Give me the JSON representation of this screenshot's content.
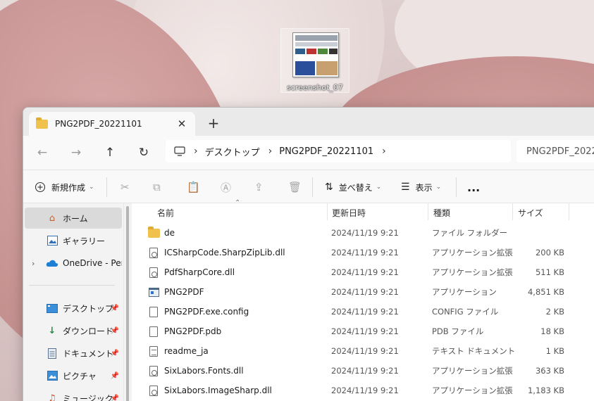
{
  "desktop": {
    "icon_label": "screenshot_07"
  },
  "tab": {
    "title": "PNG2PDF_20221101",
    "close": "✕",
    "new": "+"
  },
  "nav": {
    "back": "←",
    "forward": "→",
    "up": "↑",
    "refresh": "↻",
    "breadcrumbs": [
      "デスクトップ",
      "PNG2PDF_20221101"
    ],
    "search_text": "PNG2PDF_2022"
  },
  "toolbar": {
    "new_label": "新規作成",
    "sort_label": "並べ替え",
    "view_label": "表示",
    "more": "..."
  },
  "sidebar": {
    "items": [
      {
        "label": "ホーム",
        "icon": "home-icon"
      },
      {
        "label": "ギャラリー",
        "icon": "gallery-icon"
      },
      {
        "label": "OneDrive - Perso",
        "icon": "onedrive-icon"
      },
      {
        "label": "デスクトップ",
        "icon": "desktop-icon"
      },
      {
        "label": "ダウンロード",
        "icon": "download-icon"
      },
      {
        "label": "ドキュメント",
        "icon": "documents-icon"
      },
      {
        "label": "ピクチャ",
        "icon": "pictures-icon"
      },
      {
        "label": "ミュージック",
        "icon": "music-icon"
      }
    ]
  },
  "columns": {
    "name": "名前",
    "date": "更新日時",
    "type": "種類",
    "size": "サイズ"
  },
  "files": [
    {
      "name": "de",
      "date": "2024/11/19 9:21",
      "type": "ファイル フォルダー",
      "size": "",
      "icon": "folder-icon"
    },
    {
      "name": "ICSharpCode.SharpZipLib.dll",
      "date": "2024/11/19 9:21",
      "type": "アプリケーション拡張",
      "size": "200 KB",
      "icon": "dll-icon"
    },
    {
      "name": "PdfSharpCore.dll",
      "date": "2024/11/19 9:21",
      "type": "アプリケーション拡張",
      "size": "511 KB",
      "icon": "dll-icon"
    },
    {
      "name": "PNG2PDF",
      "date": "2024/11/19 9:21",
      "type": "アプリケーション",
      "size": "4,851 KB",
      "icon": "exe-icon"
    },
    {
      "name": "PNG2PDF.exe.config",
      "date": "2024/11/19 9:21",
      "type": "CONFIG ファイル",
      "size": "2 KB",
      "icon": "file-icon"
    },
    {
      "name": "PNG2PDF.pdb",
      "date": "2024/11/19 9:21",
      "type": "PDB ファイル",
      "size": "18 KB",
      "icon": "file-icon"
    },
    {
      "name": "readme_ja",
      "date": "2024/11/19 9:21",
      "type": "テキスト ドキュメント",
      "size": "1 KB",
      "icon": "text-icon"
    },
    {
      "name": "SixLabors.Fonts.dll",
      "date": "2024/11/19 9:21",
      "type": "アプリケーション拡張",
      "size": "363 KB",
      "icon": "dll-icon"
    },
    {
      "name": "SixLabors.ImageSharp.dll",
      "date": "2024/11/19 9:21",
      "type": "アプリケーション拡張",
      "size": "1,183 KB",
      "icon": "dll-icon"
    }
  ]
}
